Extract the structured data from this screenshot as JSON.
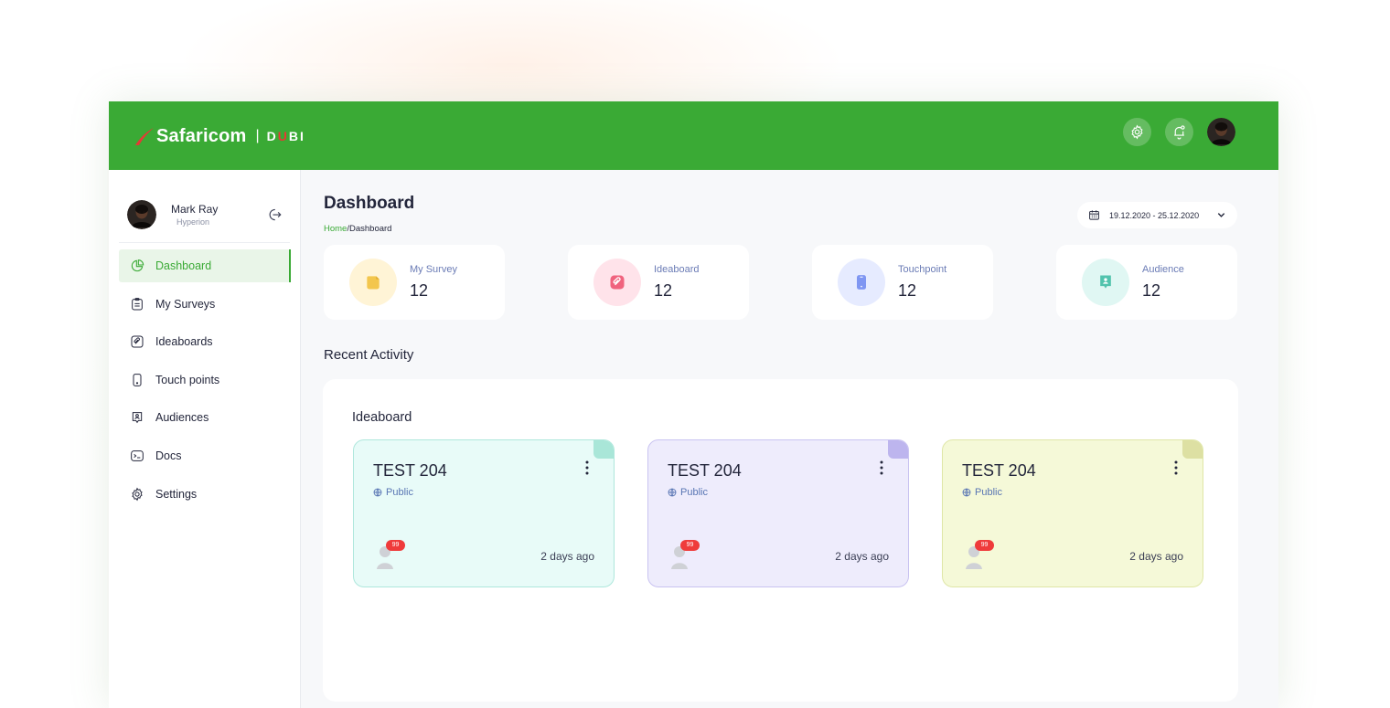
{
  "brand": {
    "name": "Safaricom",
    "separator": "|",
    "product_start": "D",
    "product_accent": "U",
    "product_end": "BI",
    "color": "#3aaa35",
    "accent_color": "#e53935"
  },
  "topbar": {
    "icons": [
      "gear-icon",
      "bell-icon",
      "avatar"
    ]
  },
  "user": {
    "name": "Mark Ray",
    "org": "Hyperion"
  },
  "sidebar": {
    "items": [
      {
        "label": "Dashboard",
        "icon": "pie-chart-icon",
        "active": true
      },
      {
        "label": "My Surveys",
        "icon": "survey-icon",
        "active": false
      },
      {
        "label": "Ideaboards",
        "icon": "ideaboard-icon",
        "active": false
      },
      {
        "label": "Touch points",
        "icon": "phone-icon",
        "active": false
      },
      {
        "label": "Audiences",
        "icon": "audience-icon",
        "active": false
      },
      {
        "label": "Docs",
        "icon": "terminal-icon",
        "active": false
      },
      {
        "label": "Settings",
        "icon": "gear-icon",
        "active": false
      }
    ]
  },
  "page": {
    "title": "Dashboard",
    "breadcrumb_home": "Home",
    "breadcrumb_sep": "/",
    "breadcrumb_current": "Dashboard"
  },
  "date_range": {
    "value": "19.12.2020 - 25.12.2020"
  },
  "stats": [
    {
      "label": "My Survey",
      "value": "12",
      "icon": "survey-icon",
      "bg": "#fff4d6",
      "fg": "#f3c64d"
    },
    {
      "label": "Ideaboard",
      "value": "12",
      "icon": "ideaboard-icon",
      "bg": "#ffe3ea",
      "fg": "#f0637e"
    },
    {
      "label": "Touchpoint",
      "value": "12",
      "icon": "phone-icon",
      "bg": "#e6ebff",
      "fg": "#7f96f2"
    },
    {
      "label": "Audience",
      "value": "12",
      "icon": "audience-icon",
      "bg": "#e0f7f3",
      "fg": "#52c3ad"
    }
  ],
  "recent": {
    "title": "Recent Activity",
    "subtitle": "Ideaboard",
    "cards": [
      {
        "title": "TEST 204",
        "visibility": "Public",
        "badge": "99",
        "time": "2 days ago",
        "bg": "#e8fbf8",
        "border": "#aee7dc",
        "fold": "#a9e6d8"
      },
      {
        "title": "TEST 204",
        "visibility": "Public",
        "badge": "99",
        "time": "2 days ago",
        "bg": "#eeecfc",
        "border": "#c9c3f1",
        "fold": "#bdb5ee"
      },
      {
        "title": "TEST 204",
        "visibility": "Public",
        "badge": "99",
        "time": "2 days ago",
        "bg": "#f5f9d8",
        "border": "#dfe6a7",
        "fold": "#dde0a3"
      }
    ]
  }
}
